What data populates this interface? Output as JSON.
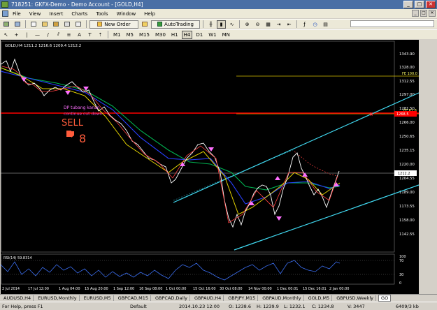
{
  "window": {
    "title": "718251: GKFX-Demo - Demo Account - [GOLD,H4]",
    "min": "_",
    "max": "□",
    "close": "✕"
  },
  "menu": [
    "File",
    "View",
    "Insert",
    "Charts",
    "Tools",
    "Window",
    "Help"
  ],
  "mdi_buttons": [
    "_",
    "□",
    "✕"
  ],
  "toolbar": {
    "new_order": "New Order",
    "autotrading": "AutoTrading",
    "timeframes": [
      "M1",
      "M5",
      "M15",
      "M30",
      "H1",
      "H4",
      "D1",
      "W1",
      "MN"
    ],
    "active_timeframe": "H4"
  },
  "chart": {
    "symbol_info": "GOLD,H4  1211.2 1216.6 1209.4 1212.2",
    "price_labels": [
      "1343.90",
      "1328.00",
      "1312.55",
      "1297.00",
      "1281.50",
      "1266.00",
      "1250.65",
      "1235.15",
      "1220.00",
      "1204.55",
      "1189.00",
      "1173.55",
      "1158.00",
      "1142.55"
    ],
    "current_price": "1212.2",
    "fe_100": "FE 100.0",
    "fe_618": "FE 61.8",
    "fe_618_value": "1268.5",
    "text_line1": "DP tubang kanan",
    "text_line2": "continue cut down",
    "sell_label": "SELL",
    "rsi_label": "RSI(14) 59.8314",
    "rsi_levels": [
      "100",
      "70",
      "30",
      "0"
    ],
    "time_labels": [
      "2 Jul 2014",
      "17 Jul 12:00",
      "1 Aug 04:00",
      "15 Aug 20:00",
      "1 Sep 12:00",
      "16 Sep 08:00",
      "1 Oct 00:00",
      "15 Oct 16:00",
      "30 Oct 08:00",
      "14 Nov 00:00",
      "1 Dec 00:01",
      "15 Dec 16:01",
      "2 Jan 00:00"
    ],
    "colors": {
      "background": "#000000",
      "price_line": "#c0c0c0",
      "fe_line": "#d4c200",
      "fe618_line": "#ff0000",
      "channel": "#40d8f0",
      "ma_green": "#00b050",
      "ma_blue": "#2840ff",
      "ma_yellow": "#e0d000",
      "rsi": "#3b6ef0",
      "bull": "#ffffff",
      "bear": "#ff4040",
      "arrow": "#ff70ff"
    }
  },
  "tabs": [
    "AUDUSD,H4",
    "EURUSD,Monthly",
    "EURUSD,M5",
    "GBPCAD,M15",
    "GBPCAD,Daily",
    "GBPAUD,H4",
    "GBPJPY,M15",
    "GBPAUD,Monthly",
    "GOLD,M5",
    "GBPUSD,Weekly",
    "GO"
  ],
  "active_tab": "GO",
  "status": {
    "help": "For Help, press F1",
    "profile": "Default",
    "datetime": "2014.10.23 12:00",
    "open": "O: 1238.6",
    "high": "H: 1239.9",
    "low": "L: 1232.1",
    "close": "C: 1234.8",
    "volume": "V: 3447",
    "traffic": "6409/3 kb"
  }
}
